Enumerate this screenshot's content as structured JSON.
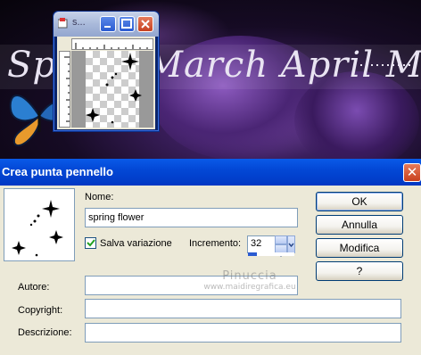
{
  "background": {
    "script_text": "Spring March April May"
  },
  "mini_window": {
    "title": "s...",
    "icons": [
      "app-icon",
      "minimize-icon",
      "maximize-icon",
      "close-icon"
    ]
  },
  "dialog": {
    "title": "Crea punta pennello",
    "name_label": "Nome:",
    "name_value": "spring flower",
    "save_variation_label": "Salva variazione",
    "save_variation_checked": true,
    "increment_label": "Incremento:",
    "increment_value": "32",
    "author_label": "Autore:",
    "author_value": "",
    "copyright_label": "Copyright:",
    "copyright_value": "",
    "description_label": "Descrizione:",
    "description_value": "",
    "buttons": {
      "ok": "OK",
      "cancel": "Annulla",
      "edit_paths": "Modifica percorsi...",
      "help": "?"
    },
    "close_glyph": "✕"
  },
  "watermark": {
    "line1": "Pinuccia",
    "line2": "www.maidiregrafica.eu"
  },
  "colors": {
    "titlebar": "#0348d6",
    "dialog_bg": "#ECE9D8",
    "close_red": "#c8401e"
  }
}
